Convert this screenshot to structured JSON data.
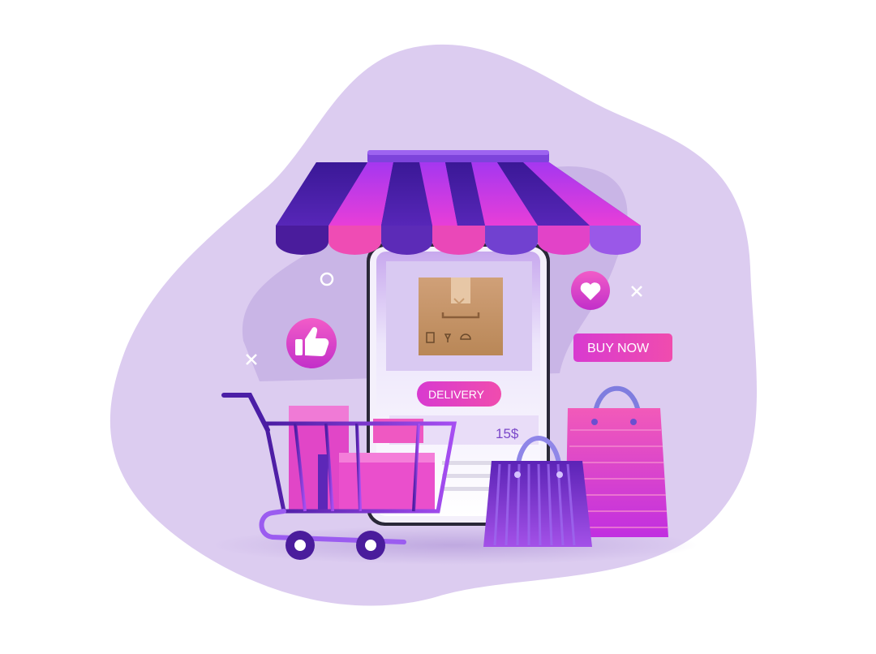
{
  "illustration": {
    "buttons": {
      "delivery_label": "DELIVERY",
      "buy_now_label": "BUY NOW"
    },
    "product_card": {
      "price": "15$"
    },
    "icons": [
      "thumbs-up-icon",
      "heart-icon",
      "shopping-cart-icon",
      "shopping-bag-icon",
      "package-box-icon",
      "close-icon",
      "circle-icon"
    ],
    "colors": {
      "blob": "#dccdf0",
      "purple": "#5a1fa8",
      "magenta": "#e93fc0",
      "violet": "#9b3df0"
    }
  }
}
